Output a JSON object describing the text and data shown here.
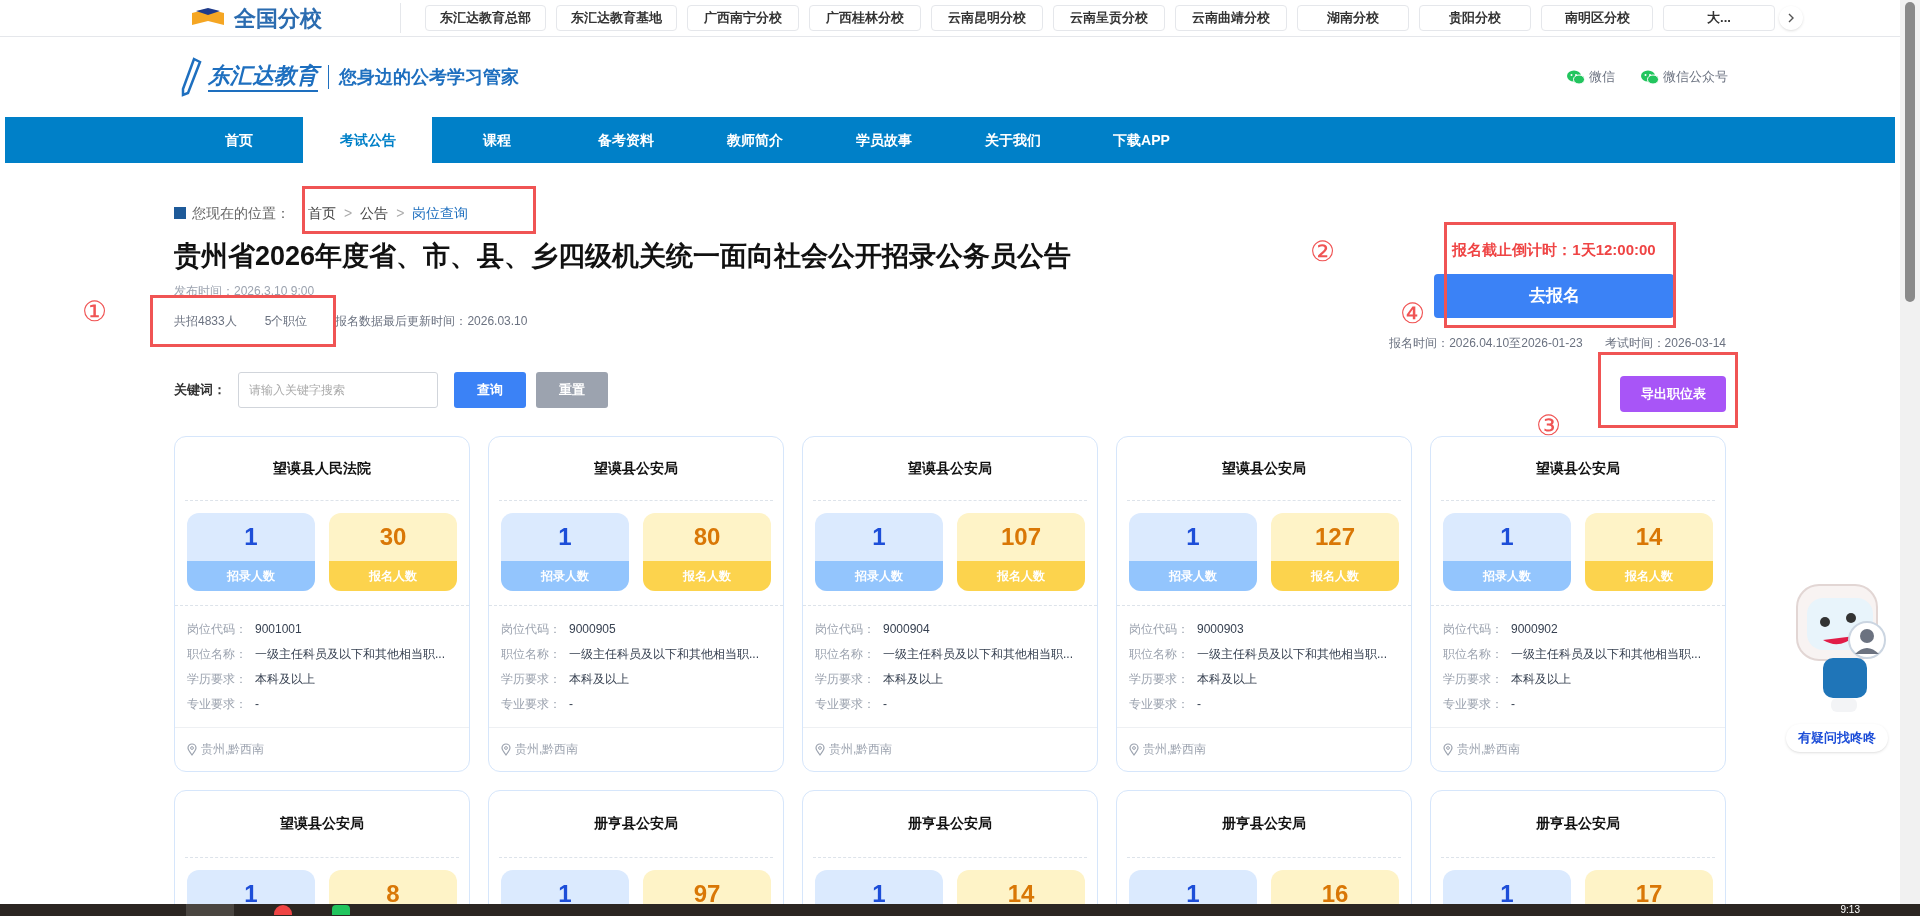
{
  "top_bar": {
    "brand": "全国分校",
    "branches": [
      "东汇达教育总部",
      "东汇达教育基地",
      "广西南宁分校",
      "广西桂林分校",
      "云南昆明分校",
      "云南呈贡分校",
      "云南曲靖分校",
      "湖南分校",
      "贵阳分校",
      "南明区分校",
      "大..."
    ]
  },
  "header": {
    "logo_text": "东汇达教育",
    "slogan": "您身边的公考学习管家",
    "links": [
      "微信",
      "微信公众号"
    ]
  },
  "nav": [
    {
      "label": "首页",
      "selected": false
    },
    {
      "label": "考试公告",
      "selected": true
    },
    {
      "label": "课程",
      "selected": false
    },
    {
      "label": "备考资料",
      "selected": false
    },
    {
      "label": "教师简介",
      "selected": false
    },
    {
      "label": "学员故事",
      "selected": false
    },
    {
      "label": "关于我们",
      "selected": false
    },
    {
      "label": "下载APP",
      "selected": false
    }
  ],
  "breadcrumb": {
    "prefix": "您现在的位置：",
    "items": [
      "首页",
      "公告",
      "岗位查询"
    ],
    "separator": ">"
  },
  "title": "贵州省2026年度省、市、县、乡四级机关统一面向社会公开招录公务员公告",
  "publish_time": "发布时间：2026.3.10 9:00",
  "stats": [
    "共招4833人",
    "5个职位",
    "报名数据最后更新时间：2026.03.10"
  ],
  "countdown": "报名截止倒计时：1天12:00:00",
  "register_button": "去报名",
  "dates": [
    "报名时间：2026.04.10至2026-01-23",
    "考试时间：2026-03-14"
  ],
  "search": {
    "label": "关键词：",
    "placeholder": "请输入关键字搜索",
    "buttons": [
      "查询",
      "重置"
    ]
  },
  "export_button": "导出职位表",
  "cards": [
    {
      "name": "望谟县人民法院",
      "hires": "1",
      "applicants": "30",
      "hires_label": "招录人数",
      "applicants_label": "报名人数",
      "details": [
        {
          "label": "岗位代码：",
          "value": "9001001"
        },
        {
          "label": "职位名称：",
          "value": "一级主任科员及以下和其他相当职..."
        },
        {
          "label": "学历要求：",
          "value": "本科及以上"
        },
        {
          "label": "专业要求：",
          "value": "-"
        }
      ],
      "location": "贵州,黔西南"
    },
    {
      "name": "望谟县公安局",
      "hires": "1",
      "applicants": "80",
      "hires_label": "招录人数",
      "applicants_label": "报名人数",
      "details": [
        {
          "label": "岗位代码：",
          "value": "9000905"
        },
        {
          "label": "职位名称：",
          "value": "一级主任科员及以下和其他相当职..."
        },
        {
          "label": "学历要求：",
          "value": "本科及以上"
        },
        {
          "label": "专业要求：",
          "value": "-"
        }
      ],
      "location": "贵州,黔西南"
    },
    {
      "name": "望谟县公安局",
      "hires": "1",
      "applicants": "107",
      "hires_label": "招录人数",
      "applicants_label": "报名人数",
      "details": [
        {
          "label": "岗位代码：",
          "value": "9000904"
        },
        {
          "label": "职位名称：",
          "value": "一级主任科员及以下和其他相当职..."
        },
        {
          "label": "学历要求：",
          "value": "本科及以上"
        },
        {
          "label": "专业要求：",
          "value": "-"
        }
      ],
      "location": "贵州,黔西南"
    },
    {
      "name": "望谟县公安局",
      "hires": "1",
      "applicants": "127",
      "hires_label": "招录人数",
      "applicants_label": "报名人数",
      "details": [
        {
          "label": "岗位代码：",
          "value": "9000903"
        },
        {
          "label": "职位名称：",
          "value": "一级主任科员及以下和其他相当职..."
        },
        {
          "label": "学历要求：",
          "value": "本科及以上"
        },
        {
          "label": "专业要求：",
          "value": "-"
        }
      ],
      "location": "贵州,黔西南"
    },
    {
      "name": "望谟县公安局",
      "hires": "1",
      "applicants": "14",
      "hires_label": "招录人数",
      "applicants_label": "报名人数",
      "details": [
        {
          "label": "岗位代码：",
          "value": "9000902"
        },
        {
          "label": "职位名称：",
          "value": "一级主任科员及以下和其他相当职..."
        },
        {
          "label": "学历要求：",
          "value": "本科及以上"
        },
        {
          "label": "专业要求：",
          "value": "-"
        }
      ],
      "location": "贵州,黔西南"
    },
    {
      "name": "望谟县公安局",
      "hires": "1",
      "applicants": "8"
    },
    {
      "name": "册亨县公安局",
      "hires": "1",
      "applicants": "97"
    },
    {
      "name": "册亨县公安局",
      "hires": "1",
      "applicants": "14"
    },
    {
      "name": "册亨县公安局",
      "hires": "1",
      "applicants": "16"
    },
    {
      "name": "册亨县公安局",
      "hires": "1",
      "applicants": "17"
    }
  ],
  "helper": {
    "label": "有疑问找咚咚"
  },
  "annotations": [
    "①",
    "②",
    "④",
    "③"
  ],
  "taskbar": {
    "time": "9:13"
  }
}
